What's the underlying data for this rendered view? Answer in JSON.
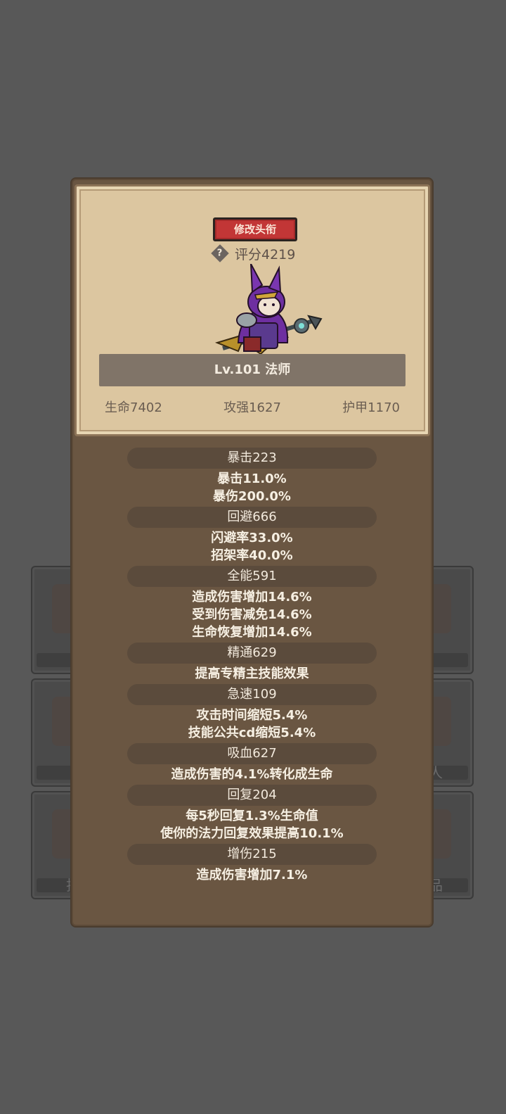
{
  "background_tiles": {
    "left": [
      "",
      "",
      "抖"
    ],
    "right": [
      "",
      "人",
      "品"
    ]
  },
  "panel": {
    "title_button": "修改头衔",
    "help_icon": "?",
    "score": "评分4219",
    "class_banner": "Lv.101 法师",
    "stats": {
      "hp": "生命7402",
      "attack": "攻强1627",
      "armor": "护甲1170"
    },
    "attributes": [
      {
        "header": "暴击223",
        "lines": [
          "暴击11.0%",
          "暴伤200.0%"
        ]
      },
      {
        "header": "回避666",
        "lines": [
          "闪避率33.0%",
          "招架率40.0%"
        ]
      },
      {
        "header": "全能591",
        "lines": [
          "造成伤害增加14.6%",
          "受到伤害减免14.6%",
          "生命恢复增加14.6%"
        ]
      },
      {
        "header": "精通629",
        "lines": [
          "提高专精主技能效果"
        ]
      },
      {
        "header": "急速109",
        "lines": [
          "攻击时间缩短5.4%",
          "技能公共cd缩短5.4%"
        ]
      },
      {
        "header": "吸血627",
        "lines": [
          "造成伤害的4.1%转化成生命"
        ]
      },
      {
        "header": "回复204",
        "lines": [
          "每5秒回复1.3%生命值",
          "使你的法力回复效果提高10.1%"
        ]
      },
      {
        "header": "增伤215",
        "lines": [
          "造成伤害增加7.1%"
        ]
      }
    ]
  },
  "colors": {
    "page_bg": "#585858",
    "panel_bg": "#6a5642",
    "card_bg": "#dcc6a0",
    "title_button": "#c23636"
  }
}
